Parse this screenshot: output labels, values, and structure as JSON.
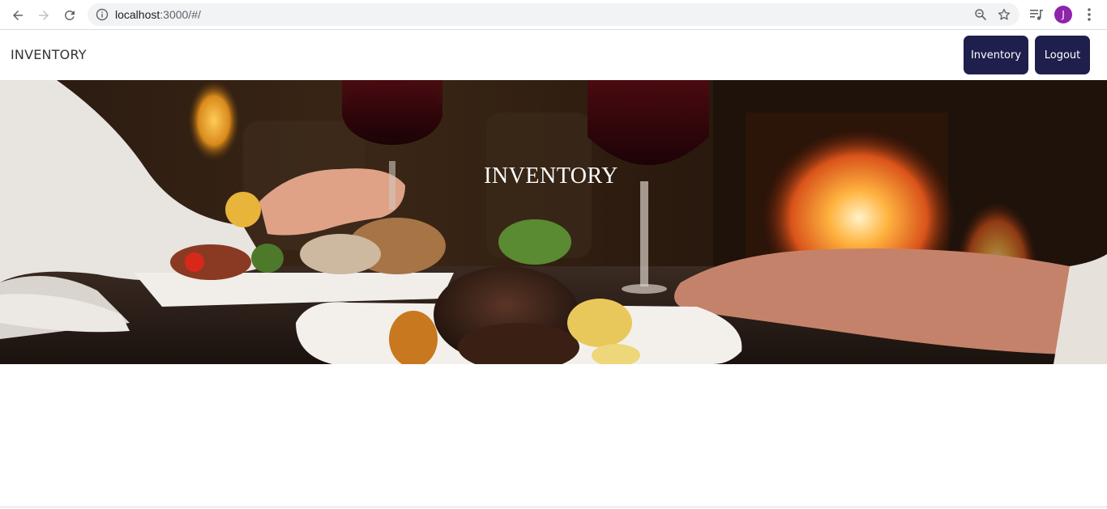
{
  "browser": {
    "url_host": "localhost",
    "url_path": ":3000/#/",
    "profile_initial": "J",
    "profile_color": "#8e24aa"
  },
  "navbar": {
    "brand": "INVENTORY",
    "inventory_button": "Inventory",
    "logout_button": "Logout",
    "button_color": "#1f1f4d"
  },
  "hero": {
    "title": "INVENTORY",
    "image_icon": "dinner-photo"
  }
}
